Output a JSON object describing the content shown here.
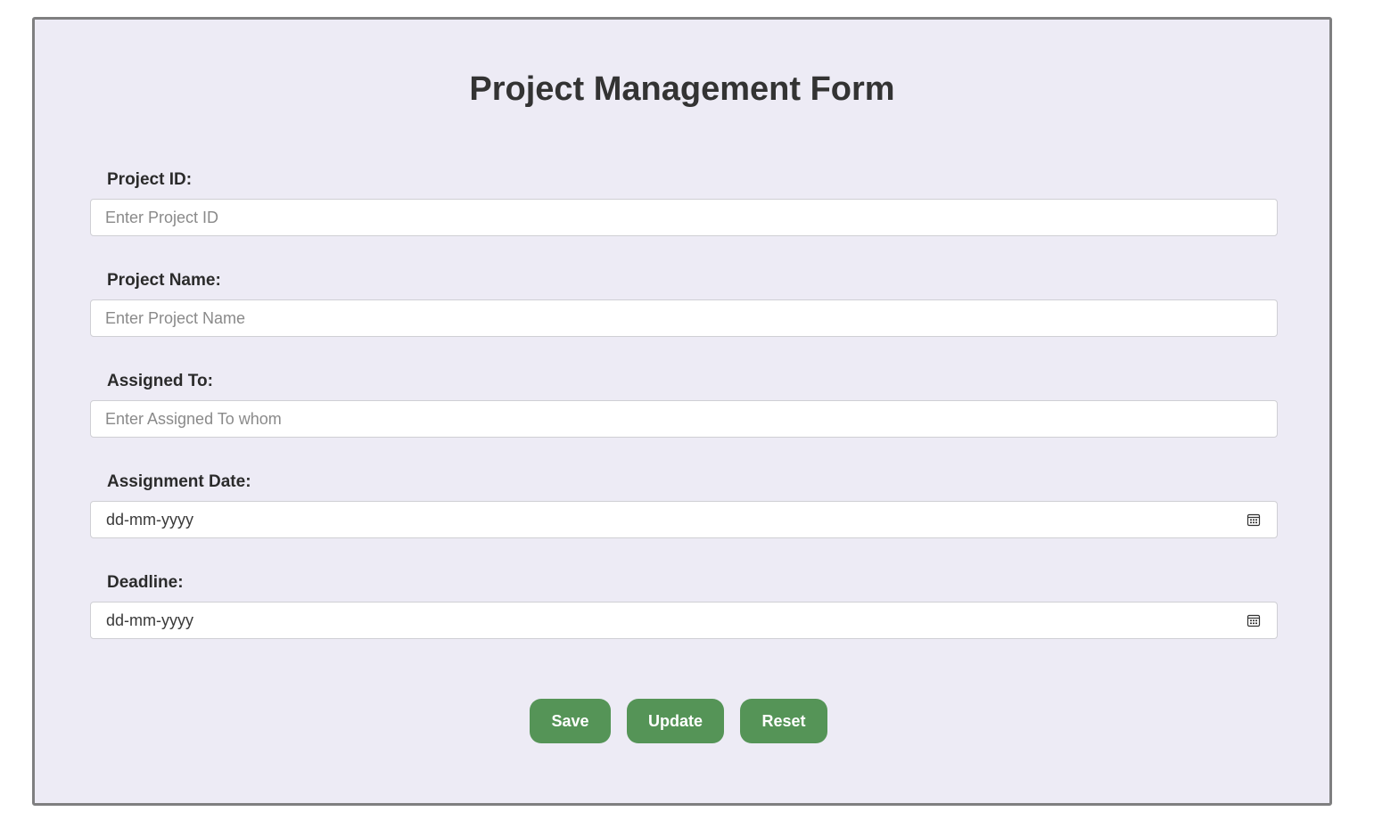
{
  "form": {
    "title": "Project Management Form",
    "fields": [
      {
        "label": "Project ID:",
        "placeholder": "Enter Project ID",
        "type": "text"
      },
      {
        "label": "Project Name:",
        "placeholder": "Enter Project Name",
        "type": "text"
      },
      {
        "label": "Assigned To:",
        "placeholder": "Enter Assigned To whom",
        "type": "text"
      },
      {
        "label": "Assignment Date:",
        "placeholder": "dd-mm-yyyy",
        "type": "date",
        "icon": "calendar-icon"
      },
      {
        "label": "Deadline:",
        "placeholder": "dd-mm-yyyy",
        "type": "date",
        "icon": "calendar-icon"
      }
    ],
    "buttons": {
      "save_label": "Save",
      "update_label": "Update",
      "reset_label": "Reset"
    }
  },
  "colors": {
    "card_background": "#edebf5",
    "card_border": "#7f7f80",
    "button_background": "#559457",
    "button_text": "#ffffff",
    "title_text": "#333333"
  }
}
